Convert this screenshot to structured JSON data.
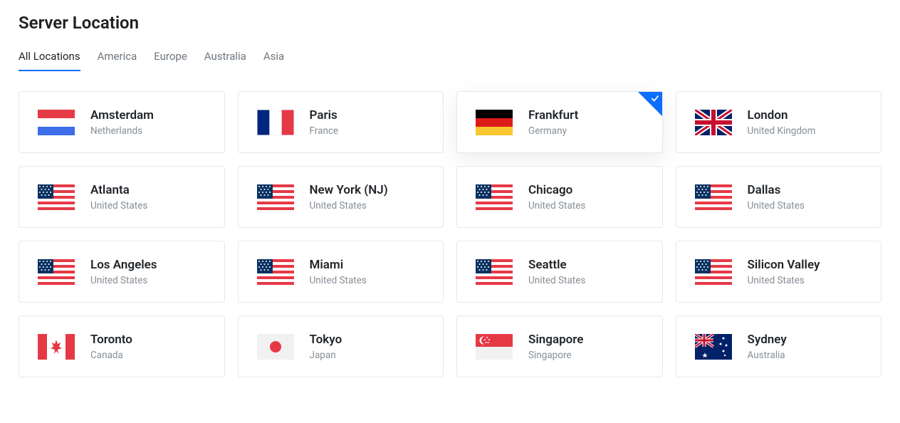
{
  "title": "Server Location",
  "tabs": [
    {
      "label": "All Locations",
      "active": true
    },
    {
      "label": "America",
      "active": false
    },
    {
      "label": "Europe",
      "active": false
    },
    {
      "label": "Australia",
      "active": false
    },
    {
      "label": "Asia",
      "active": false
    }
  ],
  "selected_id": "frankfurt",
  "locations": [
    {
      "id": "amsterdam",
      "city": "Amsterdam",
      "country": "Netherlands",
      "flag": "nl"
    },
    {
      "id": "paris",
      "city": "Paris",
      "country": "France",
      "flag": "fr"
    },
    {
      "id": "frankfurt",
      "city": "Frankfurt",
      "country": "Germany",
      "flag": "de"
    },
    {
      "id": "london",
      "city": "London",
      "country": "United Kingdom",
      "flag": "gb"
    },
    {
      "id": "atlanta",
      "city": "Atlanta",
      "country": "United States",
      "flag": "us"
    },
    {
      "id": "new-york",
      "city": "New York (NJ)",
      "country": "United States",
      "flag": "us"
    },
    {
      "id": "chicago",
      "city": "Chicago",
      "country": "United States",
      "flag": "us"
    },
    {
      "id": "dallas",
      "city": "Dallas",
      "country": "United States",
      "flag": "us"
    },
    {
      "id": "los-angeles",
      "city": "Los Angeles",
      "country": "United States",
      "flag": "us"
    },
    {
      "id": "miami",
      "city": "Miami",
      "country": "United States",
      "flag": "us"
    },
    {
      "id": "seattle",
      "city": "Seattle",
      "country": "United States",
      "flag": "us"
    },
    {
      "id": "silicon-valley",
      "city": "Silicon Valley",
      "country": "United States",
      "flag": "us"
    },
    {
      "id": "toronto",
      "city": "Toronto",
      "country": "Canada",
      "flag": "ca"
    },
    {
      "id": "tokyo",
      "city": "Tokyo",
      "country": "Japan",
      "flag": "jp"
    },
    {
      "id": "singapore",
      "city": "Singapore",
      "country": "Singapore",
      "flag": "sg"
    },
    {
      "id": "sydney",
      "city": "Sydney",
      "country": "Australia",
      "flag": "au"
    }
  ]
}
